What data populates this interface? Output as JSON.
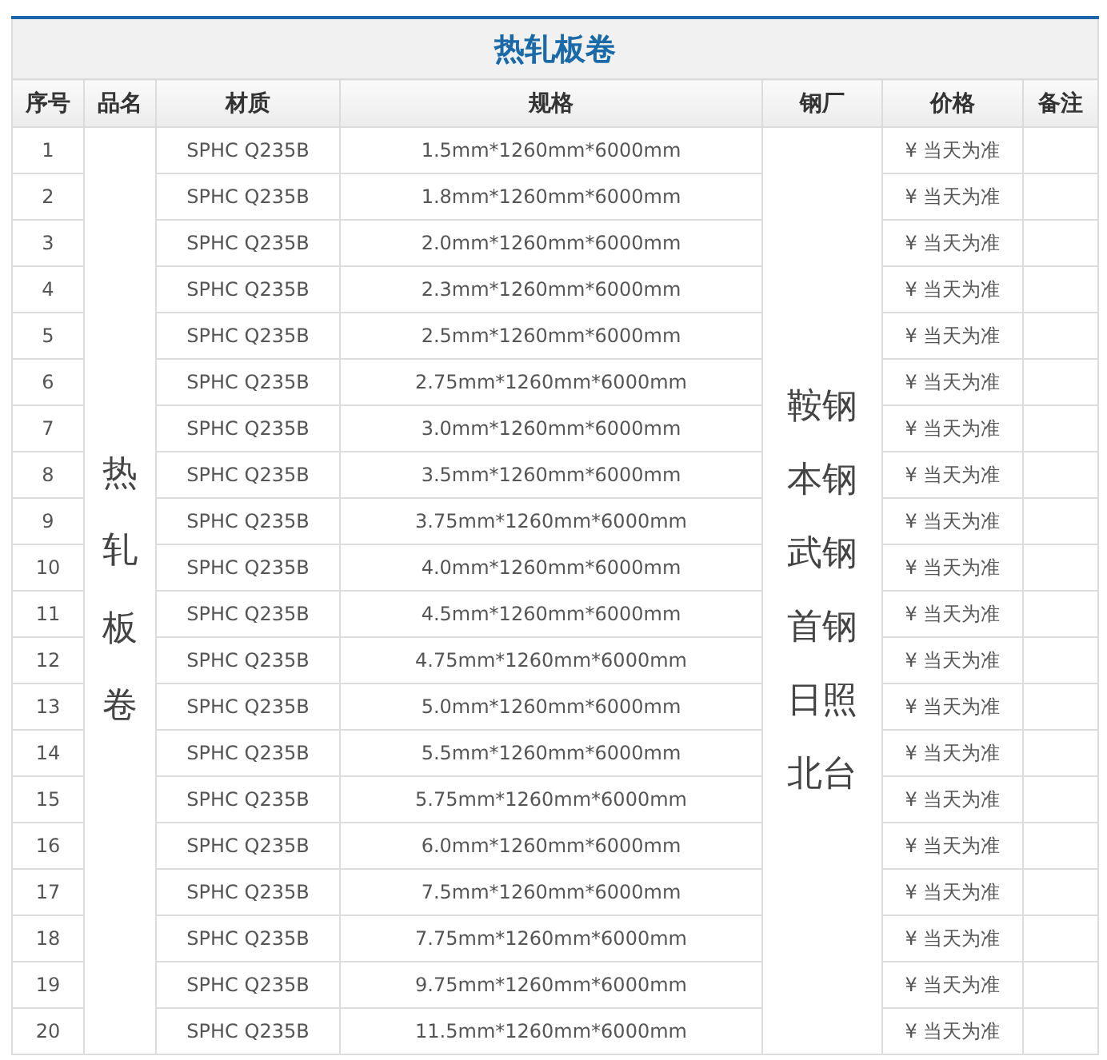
{
  "title": "热轧板卷",
  "columns": [
    "序号",
    "品名",
    "材质",
    "规格",
    "钢厂",
    "价格",
    "备注"
  ],
  "product_name": "热轧板卷",
  "mills": [
    "鞍钢",
    "本钢",
    "武钢",
    "首钢",
    "日照",
    "北台"
  ],
  "rows": [
    {
      "no": "1",
      "material": "SPHC Q235B",
      "spec": "1.5mm*1260mm*6000mm",
      "price": "¥ 当天为准"
    },
    {
      "no": "2",
      "material": "SPHC Q235B",
      "spec": "1.8mm*1260mm*6000mm",
      "price": "¥ 当天为准"
    },
    {
      "no": "3",
      "material": "SPHC Q235B",
      "spec": "2.0mm*1260mm*6000mm",
      "price": "¥ 当天为准"
    },
    {
      "no": "4",
      "material": "SPHC Q235B",
      "spec": "2.3mm*1260mm*6000mm",
      "price": "¥ 当天为准"
    },
    {
      "no": "5",
      "material": "SPHC Q235B",
      "spec": "2.5mm*1260mm*6000mm",
      "price": "¥ 当天为准"
    },
    {
      "no": "6",
      "material": "SPHC Q235B",
      "spec": "2.75mm*1260mm*6000mm",
      "price": "¥ 当天为准"
    },
    {
      "no": "7",
      "material": "SPHC Q235B",
      "spec": "3.0mm*1260mm*6000mm",
      "price": "¥ 当天为准"
    },
    {
      "no": "8",
      "material": "SPHC Q235B",
      "spec": "3.5mm*1260mm*6000mm",
      "price": "¥ 当天为准"
    },
    {
      "no": "9",
      "material": "SPHC Q235B",
      "spec": "3.75mm*1260mm*6000mm",
      "price": "¥ 当天为准"
    },
    {
      "no": "10",
      "material": "SPHC Q235B",
      "spec": "4.0mm*1260mm*6000mm",
      "price": "¥ 当天为准"
    },
    {
      "no": "11",
      "material": "SPHC Q235B",
      "spec": "4.5mm*1260mm*6000mm",
      "price": "¥ 当天为准"
    },
    {
      "no": "12",
      "material": "SPHC Q235B",
      "spec": "4.75mm*1260mm*6000mm",
      "price": "¥ 当天为准"
    },
    {
      "no": "13",
      "material": "SPHC Q235B",
      "spec": "5.0mm*1260mm*6000mm",
      "price": "¥ 当天为准"
    },
    {
      "no": "14",
      "material": "SPHC Q235B",
      "spec": "5.5mm*1260mm*6000mm",
      "price": "¥ 当天为准"
    },
    {
      "no": "15",
      "material": "SPHC Q235B",
      "spec": "5.75mm*1260mm*6000mm",
      "price": "¥ 当天为准"
    },
    {
      "no": "16",
      "material": "SPHC Q235B",
      "spec": "6.0mm*1260mm*6000mm",
      "price": "¥ 当天为准"
    },
    {
      "no": "17",
      "material": "SPHC Q235B",
      "spec": "7.5mm*1260mm*6000mm",
      "price": "¥ 当天为准"
    },
    {
      "no": "18",
      "material": "SPHC Q235B",
      "spec": "7.75mm*1260mm*6000mm",
      "price": "¥ 当天为准"
    },
    {
      "no": "19",
      "material": "SPHC Q235B",
      "spec": "9.75mm*1260mm*6000mm",
      "price": "¥ 当天为准"
    },
    {
      "no": "20",
      "material": "SPHC Q235B",
      "spec": "11.5mm*1260mm*6000mm",
      "price": "¥ 当天为准"
    }
  ]
}
